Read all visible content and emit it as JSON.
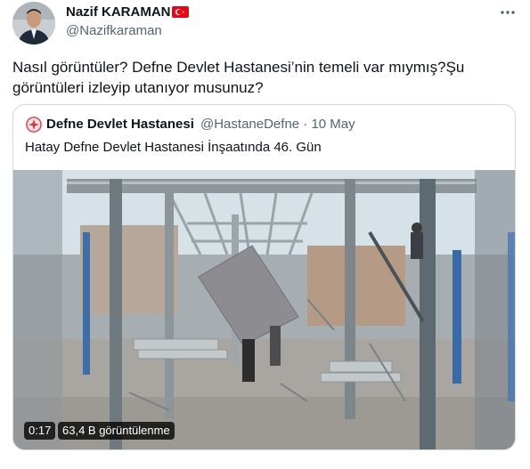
{
  "author": {
    "name": "Nazif KARAMAN",
    "handle": "@Nazifkaraman",
    "flag_icon": "turkey-flag-icon",
    "more_icon": "more-horizontal-icon"
  },
  "tweet": {
    "text": "Nasıl görüntüler? Defne Devlet Hastanesi’nin temeli var mıymış?Şu görüntüleri izleyip utanıyor musunuz?"
  },
  "quoted": {
    "name": "Defne Devlet Hastanesi",
    "handle_date": "@HastaneDefne · 10 May",
    "text": "Hatay Defne Devlet Hastanesi İnşaatında 46. Gün",
    "video": {
      "duration": "0:17",
      "views": "63,4 B görüntülenme"
    }
  },
  "colors": {
    "text_primary": "#0f1419",
    "text_secondary": "#536471",
    "border": "#cfd9de",
    "flag_red": "#e30a17"
  }
}
